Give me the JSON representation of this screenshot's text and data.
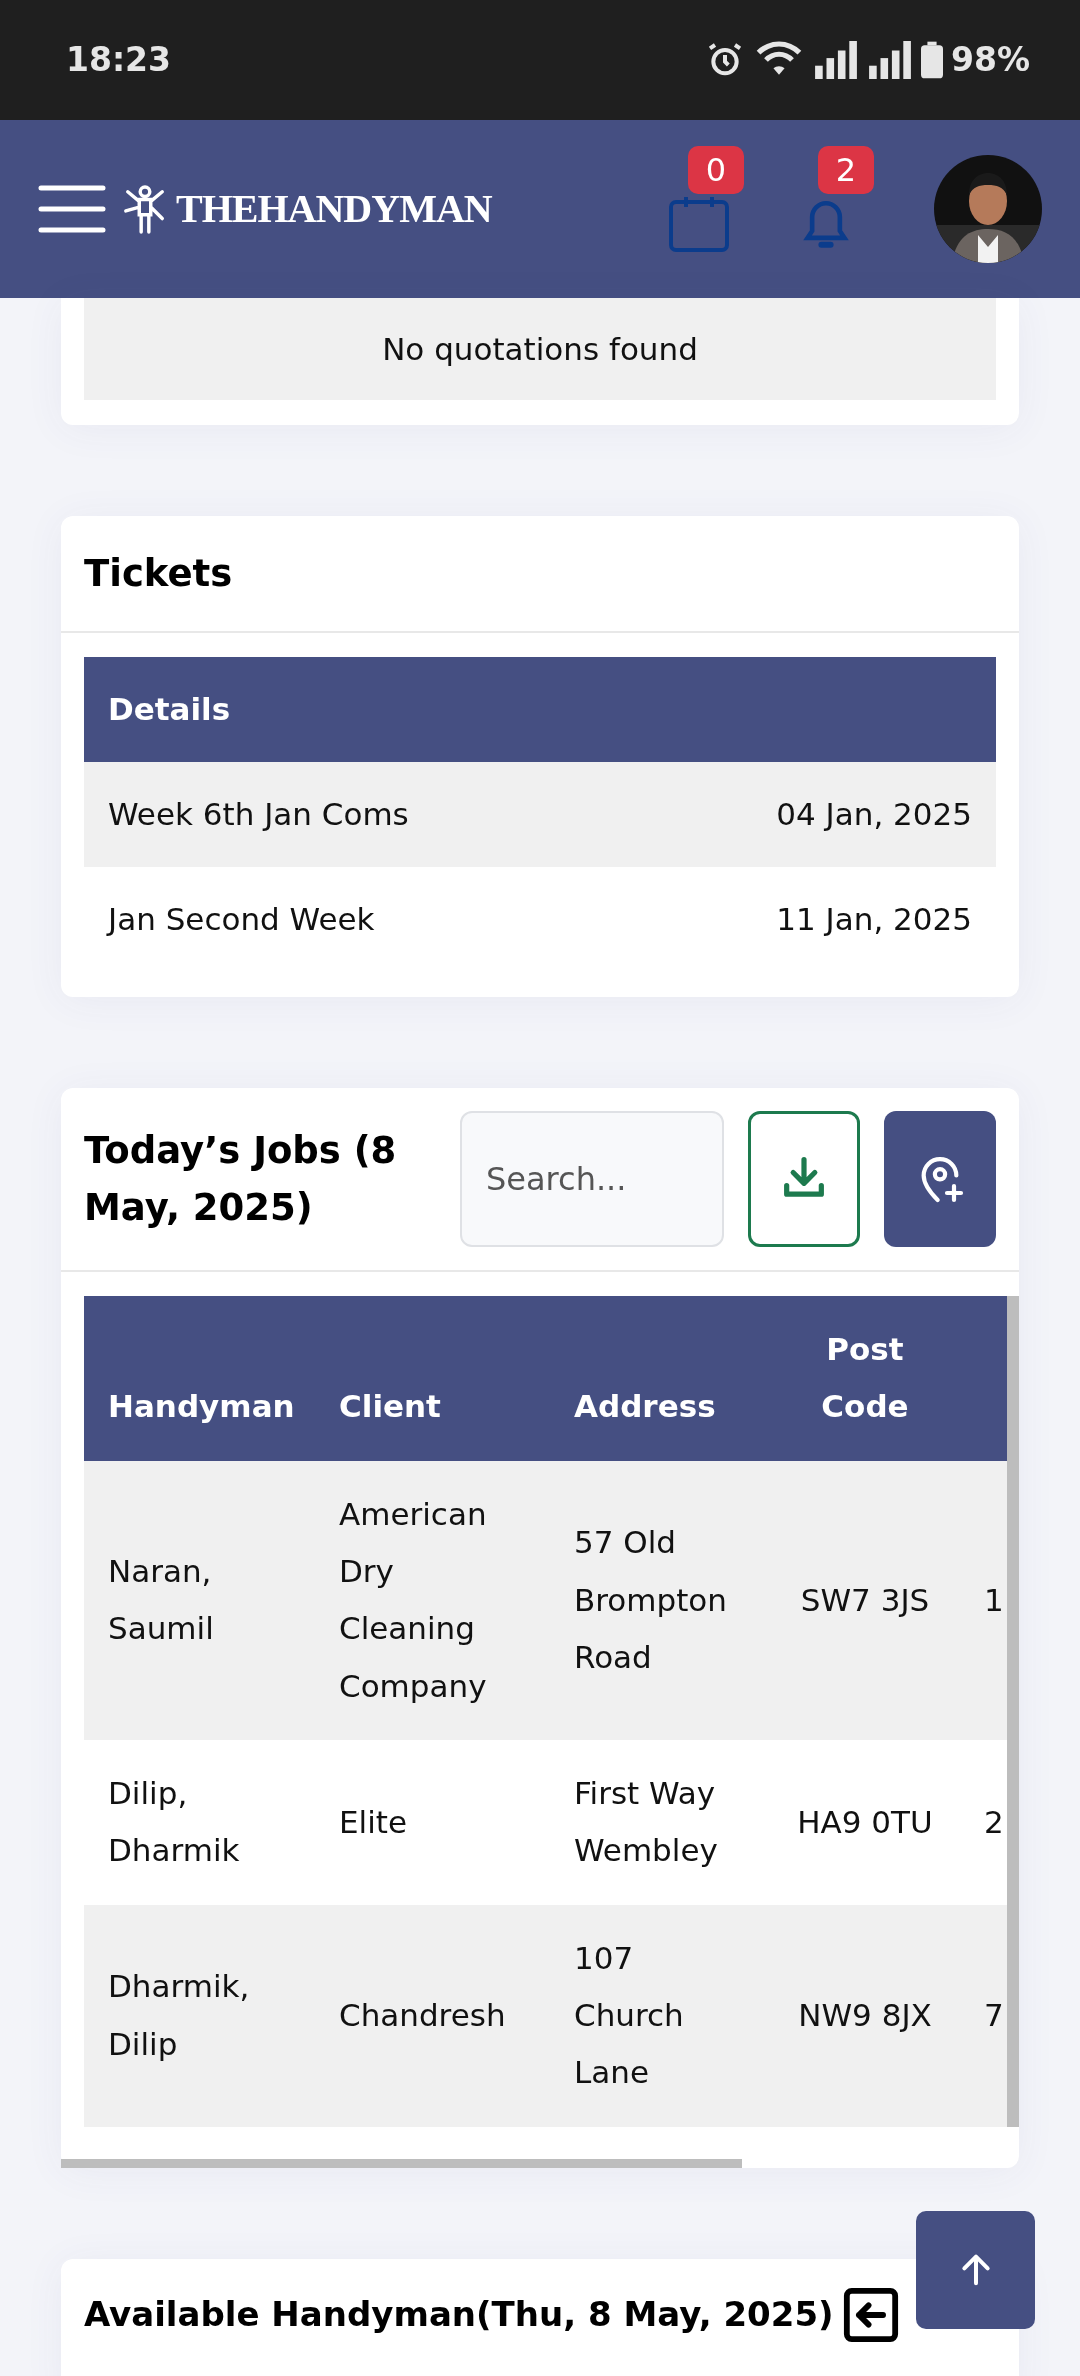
{
  "status_bar": {
    "time": "18:23",
    "battery": "98%"
  },
  "header": {
    "brand": "THEHANDYMAN",
    "calendar_count": "0",
    "notification_count": "2"
  },
  "quotations": {
    "empty_message": "No quotations found"
  },
  "tickets": {
    "title": "Tickets",
    "columns": [
      "Details"
    ],
    "rows": [
      {
        "name": "Week 6th Jan Coms",
        "date": "04 Jan, 2025"
      },
      {
        "name": "Jan Second Week",
        "date": "11 Jan, 2025"
      }
    ]
  },
  "todays_jobs": {
    "title": "Today’s Jobs (8 May, 2025)",
    "search": {
      "placeholder": "Search..."
    },
    "columns": [
      "Handyman",
      "Client",
      "Address",
      "Post Code"
    ],
    "rows": [
      {
        "handyman": "Naran, Saumil",
        "client": "American Dry Cleaning Company",
        "address": "57 Old Brompton Road",
        "post_code": "SW7 3JS",
        "column_5": "1"
      },
      {
        "handyman": "Dilip, Dharmik",
        "client": "Elite",
        "address": "First Way Wembley",
        "post_code": "HA9 0TU",
        "column_5": "2"
      },
      {
        "handyman": "Dharmik, Dilip",
        "client": "Chandresh",
        "address": "107 Church Lane",
        "post_code": "NW9 8JX",
        "column_5": "7"
      }
    ]
  },
  "available_handyman": {
    "title": "Available Handyman(Thu, 8 May, 2025)"
  }
}
